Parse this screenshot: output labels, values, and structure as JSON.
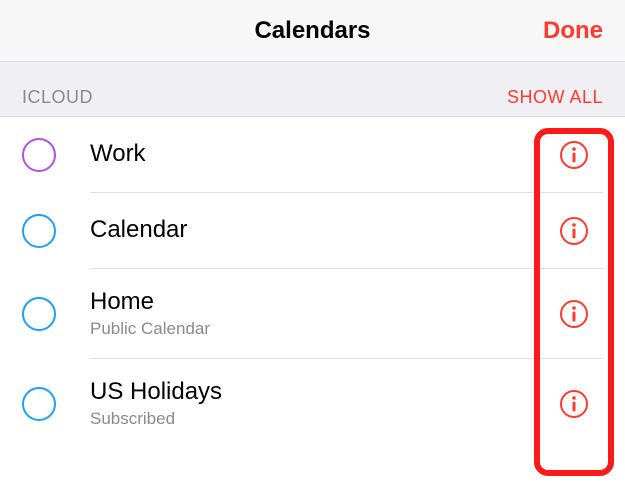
{
  "header": {
    "title": "Calendars",
    "done": "Done"
  },
  "section": {
    "label": "ICLOUD",
    "action": "SHOW ALL"
  },
  "calendars": [
    {
      "title": "Work",
      "subtitle": "",
      "color": "purple"
    },
    {
      "title": "Calendar",
      "subtitle": "",
      "color": "blue"
    },
    {
      "title": "Home",
      "subtitle": "Public Calendar",
      "color": "blue"
    },
    {
      "title": "US Holidays",
      "subtitle": "Subscribed",
      "color": "blue"
    }
  ]
}
